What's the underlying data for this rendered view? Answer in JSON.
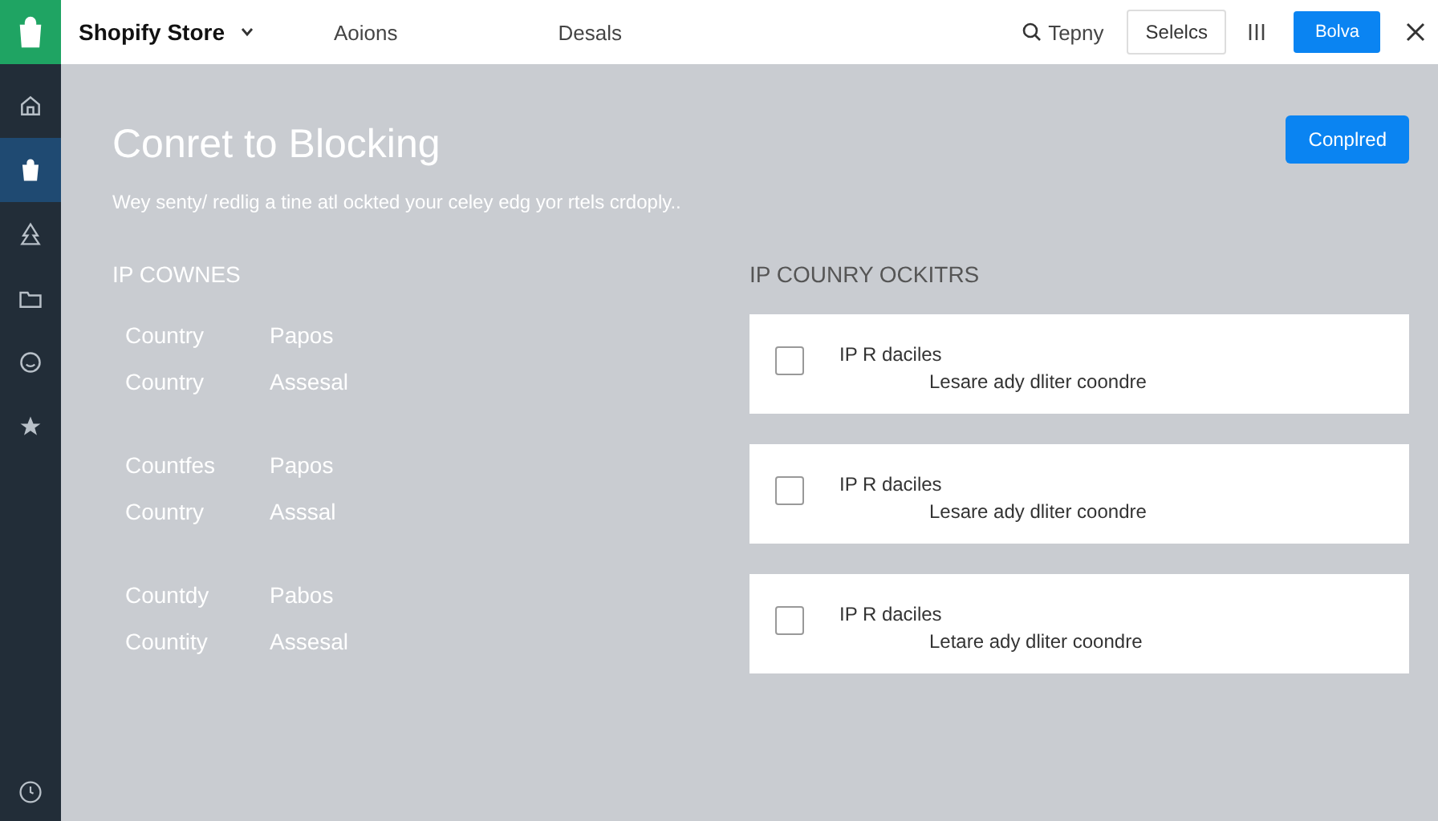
{
  "header": {
    "store_name": "Shopify Store",
    "nav": [
      "Aoions",
      "Desals"
    ],
    "search": {
      "label": "Tepny"
    },
    "select_button": "Selelcs",
    "primary_button": "Bolva"
  },
  "sidebar": {
    "items": [
      {
        "selected": false
      },
      {
        "selected": true
      },
      {
        "selected": false
      },
      {
        "selected": false
      },
      {
        "selected": false
      },
      {
        "selected": false
      }
    ]
  },
  "page": {
    "title": "Conret to Blocking",
    "subtitle": "Wey senty/ redlig a tine atl ockted your celey edg yor rtels crdoply..",
    "action_button": "Conplred"
  },
  "countries": {
    "heading": "IP COWNES",
    "groups": [
      [
        {
          "label": "Country",
          "value": "Papos"
        },
        {
          "label": "Country",
          "value": "Assesal"
        }
      ],
      [
        {
          "label": "Countfes",
          "value": "Papos"
        },
        {
          "label": "Country",
          "value": "Asssal"
        }
      ],
      [
        {
          "label": "Countdy",
          "value": "Pabos"
        },
        {
          "label": "Countity",
          "value": "Assesal"
        }
      ]
    ]
  },
  "blockers": {
    "heading": "IP COUNRY OCKITRS",
    "items": [
      {
        "title": "IP R daciles",
        "description": "Lesare ady dliter coondre",
        "checked": false
      },
      {
        "title": "IP R daciles",
        "description": "Lesare ady dliter coondre",
        "checked": false
      },
      {
        "title": "IP R daciles",
        "description": "Letare ady dliter coondre",
        "checked": false
      }
    ]
  }
}
